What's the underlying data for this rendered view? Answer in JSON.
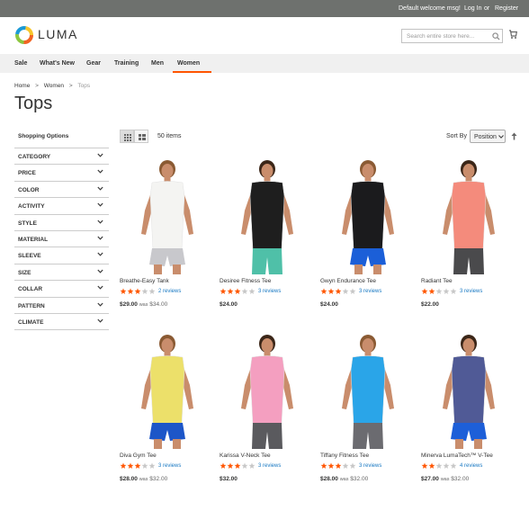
{
  "topbar": {
    "welcome": "Default welcome msg!",
    "login": "Log In",
    "or": "or",
    "register": "Register"
  },
  "header": {
    "logo_text": "LUMA",
    "search_placeholder": "Search entire store here..."
  },
  "nav": [
    "Sale",
    "What's New",
    "Gear",
    "Training",
    "Men",
    "Women"
  ],
  "nav_active": "Women",
  "breadcrumb": {
    "home": "Home",
    "women": "Women",
    "current": "Tops",
    "sep": ">"
  },
  "page_title": "Tops",
  "sidebar": {
    "title": "Shopping Options",
    "filters": [
      "CATEGORY",
      "PRICE",
      "COLOR",
      "ACTIVITY",
      "STYLE",
      "MATERIAL",
      "SLEEVE",
      "SIZE",
      "COLLAR",
      "PATTERN",
      "CLIMATE"
    ]
  },
  "toolbar": {
    "items_count": "50 items",
    "sort_label": "Sort By",
    "sort_value": "Position"
  },
  "colors": {
    "accent": "#ff5501",
    "link": "#1979c3",
    "star": "#ff5501",
    "topbar": "#6e716e"
  },
  "products": [
    {
      "name": "Breathe-Easy Tank",
      "rating": 3,
      "reviews": "2 reviews",
      "price": "$29.00",
      "was_label": "was",
      "was": "$34.00",
      "top": "#f4f4f2",
      "bottom": "#c8c8cc",
      "bottom_type": "shorts"
    },
    {
      "name": "Desiree Fitness Tee",
      "rating": 3,
      "reviews": "3 reviews",
      "price": "$24.00",
      "was_label": "",
      "was": "",
      "top": "#1e1e1e",
      "bottom": "#4fc0a8",
      "bottom_type": "pants"
    },
    {
      "name": "Gwyn Endurance Tee",
      "rating": 3,
      "reviews": "3 reviews",
      "price": "$24.00",
      "was_label": "",
      "was": "",
      "top": "#1b1b1d",
      "bottom": "#1b5fd8",
      "bottom_type": "shorts"
    },
    {
      "name": "Radiant Tee",
      "rating": 2,
      "reviews": "3 reviews",
      "price": "$22.00",
      "was_label": "",
      "was": "",
      "top": "#f48b7c",
      "bottom": "#4a4a4c",
      "bottom_type": "pants"
    },
    {
      "name": "Diva Gym Tee",
      "rating": 3,
      "reviews": "3 reviews",
      "price": "$28.00",
      "was_label": "was",
      "was": "$32.00",
      "top": "#ece06a",
      "bottom": "#1d56c8",
      "bottom_type": "shorts"
    },
    {
      "name": "Karissa V-Neck Tee",
      "rating": 3,
      "reviews": "3 reviews",
      "price": "$32.00",
      "was_label": "",
      "was": "",
      "top": "#f49fc0",
      "bottom": "#5a5a5e",
      "bottom_type": "pants"
    },
    {
      "name": "Tiffany Fitness Tee",
      "rating": 3,
      "reviews": "3 reviews",
      "price": "$28.00",
      "was_label": "was",
      "was": "$32.00",
      "top": "#2aa5e8",
      "bottom": "#6b6b70",
      "bottom_type": "pants"
    },
    {
      "name": "Minerva LumaTech™ V-Tee",
      "rating": 2,
      "reviews": "4 reviews",
      "price": "$27.00",
      "was_label": "was",
      "was": "$32.00",
      "top": "#505a96",
      "bottom": "#1d5fd8",
      "bottom_type": "shorts"
    }
  ]
}
